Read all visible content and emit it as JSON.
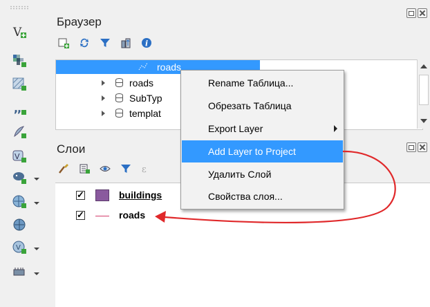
{
  "browser": {
    "title": "Браузер",
    "toolbar": [
      "add-selected-icon",
      "refresh-icon",
      "filter-icon",
      "collapse-all-icon",
      "info-icon"
    ],
    "tree": [
      {
        "label": "roads",
        "selected": true
      },
      {
        "label": "roads",
        "selected": false
      },
      {
        "label": "SubTyp",
        "selected": false
      },
      {
        "label": "templat",
        "selected": false
      }
    ]
  },
  "context_menu": {
    "items": [
      {
        "label": "Rename Таблица...",
        "highlighted": false,
        "submenu": false
      },
      {
        "label": "Обрезать Таблица",
        "highlighted": false,
        "submenu": false
      },
      {
        "label": "Export Layer",
        "highlighted": false,
        "submenu": true
      },
      {
        "label": "Add Layer to Project",
        "highlighted": true,
        "submenu": false
      },
      {
        "label": "Удалить Слой",
        "highlighted": false,
        "submenu": false
      },
      {
        "label": "Свойства слоя...",
        "highlighted": false,
        "submenu": false
      }
    ]
  },
  "layers": {
    "title": "Слои",
    "items": [
      {
        "label": "buildings",
        "checked": true,
        "symbol": "polygon",
        "color": "#8a5a9e"
      },
      {
        "label": "roads",
        "checked": true,
        "symbol": "line",
        "color": "#d43b6b"
      }
    ]
  },
  "colors": {
    "selection": "#3399ff",
    "arrow": "#e0282a"
  }
}
